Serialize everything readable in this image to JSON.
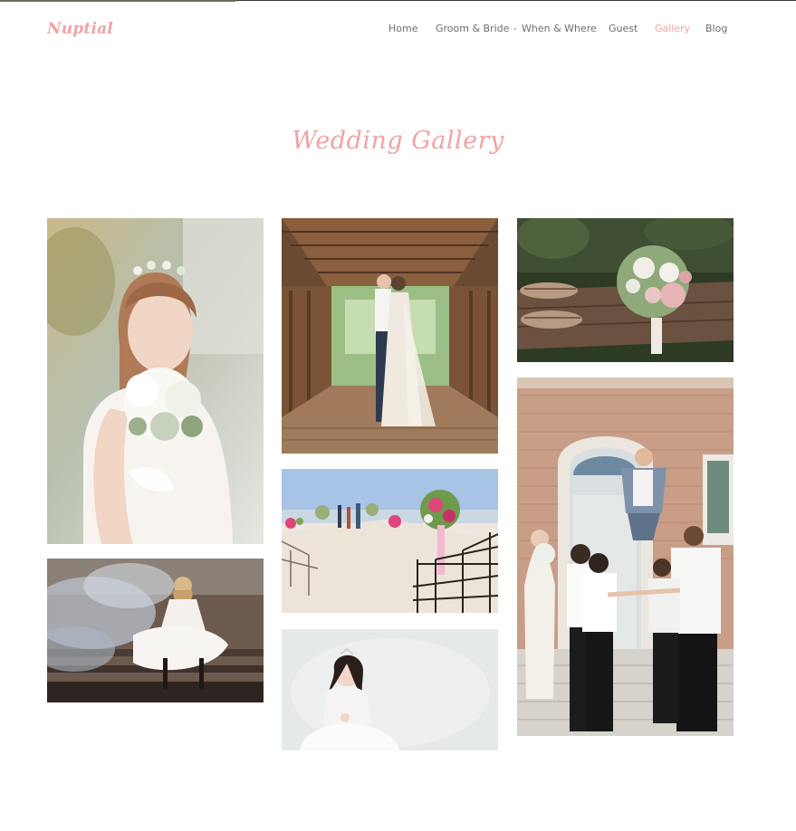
{
  "brand": {
    "logo_text": "Nuptial"
  },
  "nav": {
    "items": [
      {
        "label": "Home",
        "active": false
      },
      {
        "label": "Groom & Bride",
        "active": false,
        "has_dropdown": true
      },
      {
        "label": "When & Where",
        "active": false
      },
      {
        "label": "Guest",
        "active": false
      },
      {
        "label": "Gallery",
        "active": true
      },
      {
        "label": "Blog",
        "active": false
      }
    ]
  },
  "section": {
    "title": "Wedding Gallery"
  },
  "colors": {
    "accent": "#f1a3a3",
    "nav_text": "#6d6d6d",
    "background": "#ffffff"
  },
  "gallery": {
    "photos": [
      {
        "subject": "bride with bouquet"
      },
      {
        "subject": "couple kissing on covered bridge"
      },
      {
        "subject": "bouquet and sandals"
      },
      {
        "subject": "bride sitting on steps with smoke"
      },
      {
        "subject": "ceremony aisle with flowers"
      },
      {
        "subject": "bride portrait in white"
      },
      {
        "subject": "groomsmen tossing groom"
      }
    ]
  }
}
